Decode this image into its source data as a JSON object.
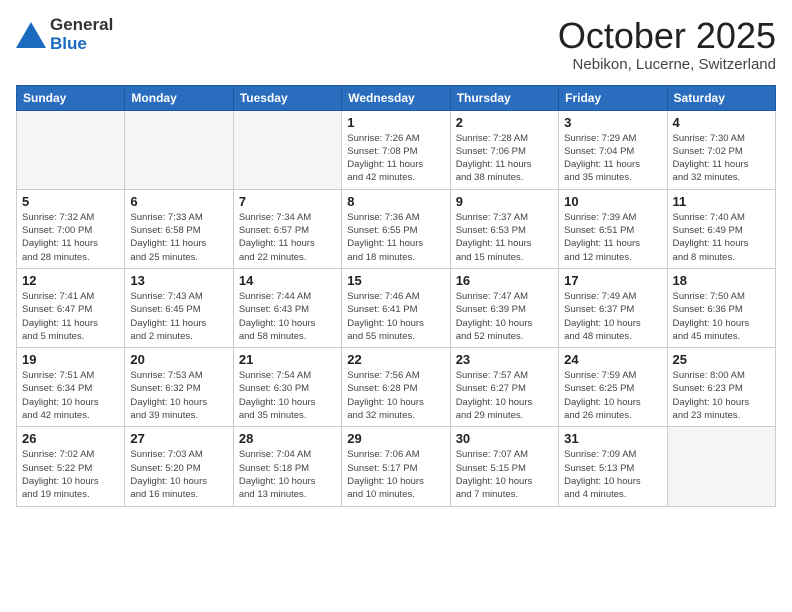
{
  "header": {
    "logo_general": "General",
    "logo_blue": "Blue",
    "month_title": "October 2025",
    "location": "Nebikon, Lucerne, Switzerland"
  },
  "weekdays": [
    "Sunday",
    "Monday",
    "Tuesday",
    "Wednesday",
    "Thursday",
    "Friday",
    "Saturday"
  ],
  "weeks": [
    [
      {
        "day": "",
        "info": ""
      },
      {
        "day": "",
        "info": ""
      },
      {
        "day": "",
        "info": ""
      },
      {
        "day": "1",
        "info": "Sunrise: 7:26 AM\nSunset: 7:08 PM\nDaylight: 11 hours\nand 42 minutes."
      },
      {
        "day": "2",
        "info": "Sunrise: 7:28 AM\nSunset: 7:06 PM\nDaylight: 11 hours\nand 38 minutes."
      },
      {
        "day": "3",
        "info": "Sunrise: 7:29 AM\nSunset: 7:04 PM\nDaylight: 11 hours\nand 35 minutes."
      },
      {
        "day": "4",
        "info": "Sunrise: 7:30 AM\nSunset: 7:02 PM\nDaylight: 11 hours\nand 32 minutes."
      }
    ],
    [
      {
        "day": "5",
        "info": "Sunrise: 7:32 AM\nSunset: 7:00 PM\nDaylight: 11 hours\nand 28 minutes."
      },
      {
        "day": "6",
        "info": "Sunrise: 7:33 AM\nSunset: 6:58 PM\nDaylight: 11 hours\nand 25 minutes."
      },
      {
        "day": "7",
        "info": "Sunrise: 7:34 AM\nSunset: 6:57 PM\nDaylight: 11 hours\nand 22 minutes."
      },
      {
        "day": "8",
        "info": "Sunrise: 7:36 AM\nSunset: 6:55 PM\nDaylight: 11 hours\nand 18 minutes."
      },
      {
        "day": "9",
        "info": "Sunrise: 7:37 AM\nSunset: 6:53 PM\nDaylight: 11 hours\nand 15 minutes."
      },
      {
        "day": "10",
        "info": "Sunrise: 7:39 AM\nSunset: 6:51 PM\nDaylight: 11 hours\nand 12 minutes."
      },
      {
        "day": "11",
        "info": "Sunrise: 7:40 AM\nSunset: 6:49 PM\nDaylight: 11 hours\nand 8 minutes."
      }
    ],
    [
      {
        "day": "12",
        "info": "Sunrise: 7:41 AM\nSunset: 6:47 PM\nDaylight: 11 hours\nand 5 minutes."
      },
      {
        "day": "13",
        "info": "Sunrise: 7:43 AM\nSunset: 6:45 PM\nDaylight: 11 hours\nand 2 minutes."
      },
      {
        "day": "14",
        "info": "Sunrise: 7:44 AM\nSunset: 6:43 PM\nDaylight: 10 hours\nand 58 minutes."
      },
      {
        "day": "15",
        "info": "Sunrise: 7:46 AM\nSunset: 6:41 PM\nDaylight: 10 hours\nand 55 minutes."
      },
      {
        "day": "16",
        "info": "Sunrise: 7:47 AM\nSunset: 6:39 PM\nDaylight: 10 hours\nand 52 minutes."
      },
      {
        "day": "17",
        "info": "Sunrise: 7:49 AM\nSunset: 6:37 PM\nDaylight: 10 hours\nand 48 minutes."
      },
      {
        "day": "18",
        "info": "Sunrise: 7:50 AM\nSunset: 6:36 PM\nDaylight: 10 hours\nand 45 minutes."
      }
    ],
    [
      {
        "day": "19",
        "info": "Sunrise: 7:51 AM\nSunset: 6:34 PM\nDaylight: 10 hours\nand 42 minutes."
      },
      {
        "day": "20",
        "info": "Sunrise: 7:53 AM\nSunset: 6:32 PM\nDaylight: 10 hours\nand 39 minutes."
      },
      {
        "day": "21",
        "info": "Sunrise: 7:54 AM\nSunset: 6:30 PM\nDaylight: 10 hours\nand 35 minutes."
      },
      {
        "day": "22",
        "info": "Sunrise: 7:56 AM\nSunset: 6:28 PM\nDaylight: 10 hours\nand 32 minutes."
      },
      {
        "day": "23",
        "info": "Sunrise: 7:57 AM\nSunset: 6:27 PM\nDaylight: 10 hours\nand 29 minutes."
      },
      {
        "day": "24",
        "info": "Sunrise: 7:59 AM\nSunset: 6:25 PM\nDaylight: 10 hours\nand 26 minutes."
      },
      {
        "day": "25",
        "info": "Sunrise: 8:00 AM\nSunset: 6:23 PM\nDaylight: 10 hours\nand 23 minutes."
      }
    ],
    [
      {
        "day": "26",
        "info": "Sunrise: 7:02 AM\nSunset: 5:22 PM\nDaylight: 10 hours\nand 19 minutes."
      },
      {
        "day": "27",
        "info": "Sunrise: 7:03 AM\nSunset: 5:20 PM\nDaylight: 10 hours\nand 16 minutes."
      },
      {
        "day": "28",
        "info": "Sunrise: 7:04 AM\nSunset: 5:18 PM\nDaylight: 10 hours\nand 13 minutes."
      },
      {
        "day": "29",
        "info": "Sunrise: 7:06 AM\nSunset: 5:17 PM\nDaylight: 10 hours\nand 10 minutes."
      },
      {
        "day": "30",
        "info": "Sunrise: 7:07 AM\nSunset: 5:15 PM\nDaylight: 10 hours\nand 7 minutes."
      },
      {
        "day": "31",
        "info": "Sunrise: 7:09 AM\nSunset: 5:13 PM\nDaylight: 10 hours\nand 4 minutes."
      },
      {
        "day": "",
        "info": ""
      }
    ]
  ]
}
